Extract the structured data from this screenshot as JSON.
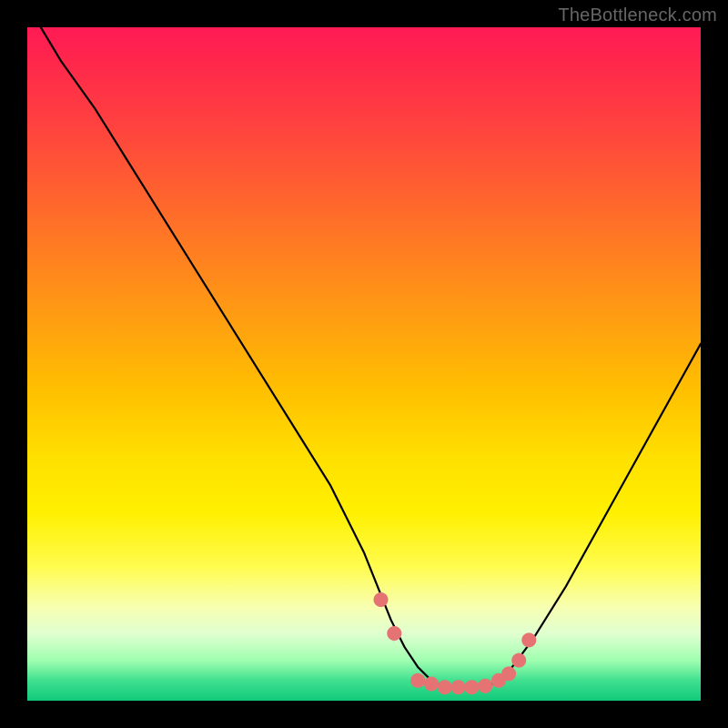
{
  "watermark": "TheBottleneck.com",
  "colors": {
    "page_bg": "#000000",
    "curve_stroke": "#000000",
    "marker_fill": "#e57373",
    "gradient_top": "#ff1a55",
    "gradient_bottom": "#10c97a"
  },
  "chart_data": {
    "type": "line",
    "title": "",
    "xlabel": "",
    "ylabel": "",
    "xlim": [
      0,
      100
    ],
    "ylim": [
      0,
      100
    ],
    "grid": false,
    "legend": false,
    "series": [
      {
        "name": "bottleneck-curve",
        "x": [
          2,
          5,
          10,
          15,
          20,
          25,
          30,
          35,
          40,
          45,
          50,
          52,
          54,
          56,
          58,
          60,
          62,
          64,
          66,
          68,
          70,
          72,
          75,
          80,
          85,
          90,
          95,
          100
        ],
        "values": [
          100,
          95,
          88,
          80,
          72,
          64,
          56,
          48,
          40,
          32,
          22,
          17,
          12,
          8,
          5,
          3,
          2,
          2,
          2,
          2,
          3,
          5,
          9,
          17,
          26,
          35,
          44,
          53
        ]
      }
    ],
    "markers": [
      {
        "x": 52.5,
        "y": 15
      },
      {
        "x": 54.5,
        "y": 10
      },
      {
        "x": 58,
        "y": 3
      },
      {
        "x": 60,
        "y": 2.5
      },
      {
        "x": 62,
        "y": 2
      },
      {
        "x": 64,
        "y": 2
      },
      {
        "x": 66,
        "y": 2
      },
      {
        "x": 68,
        "y": 2.2
      },
      {
        "x": 70,
        "y": 3
      },
      {
        "x": 71.5,
        "y": 4
      },
      {
        "x": 73,
        "y": 6
      },
      {
        "x": 74.5,
        "y": 9
      }
    ]
  }
}
